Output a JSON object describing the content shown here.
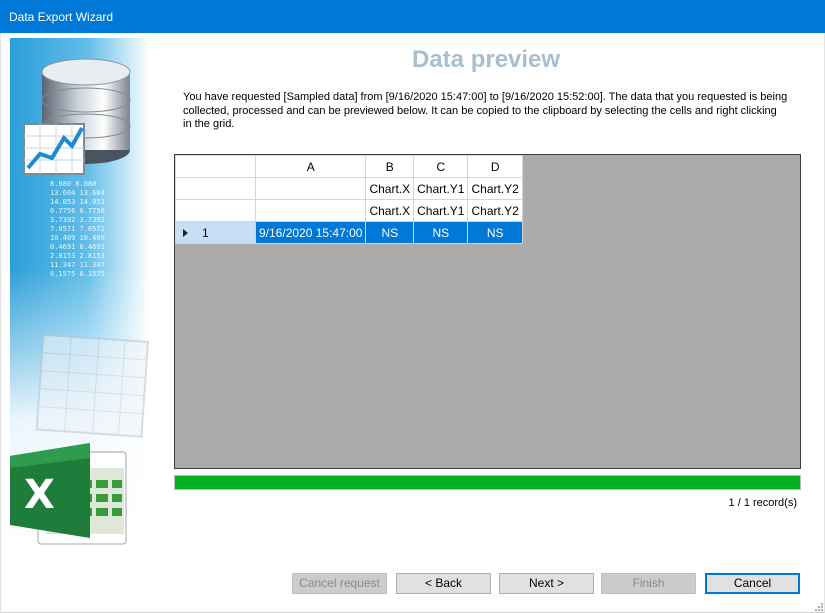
{
  "window": {
    "title": "Data Export Wizard"
  },
  "page": {
    "heading": "Data preview",
    "description": "You have requested [Sampled data] from [9/16/2020 15:47:00] to [9/16/2020 15:52:00]. The data that you requested is being collected, processed and can be previewed below. It can be copied to the clipboard by selecting the cells and right clicking in the grid."
  },
  "grid": {
    "column_headers": [
      "A",
      "B",
      "C",
      "D"
    ],
    "header_rows": [
      [
        "",
        "Chart.X",
        "Chart.Y1",
        "Chart.Y2"
      ],
      [
        "",
        "Chart.X",
        "Chart.Y1",
        "Chart.Y2"
      ]
    ],
    "rows": [
      {
        "index": "1",
        "cells": [
          "9/16/2020 15:47:00",
          "NS",
          "NS",
          "NS"
        ]
      }
    ]
  },
  "progress": {
    "value": 1.0,
    "color": "#06b025"
  },
  "record_count": "1 / 1 record(s)",
  "buttons": {
    "cancel_request": "Cancel request",
    "back": "< Back",
    "next": "Next >",
    "finish": "Finish",
    "cancel": "Cancel"
  },
  "sidebar_digits": [
    "8.880  8.880",
    "13.604  13.604",
    "14.053  14.053",
    "6.7756  6.7756",
    "3.7392  3.7392",
    "7.0571  7.0571",
    "10.409  10.409",
    "0.4691  0.4691",
    "2.8153  2.8153",
    "11.347  11.347",
    "6.1575  6.1575"
  ],
  "colors": {
    "accent": "#0078d7",
    "heading": "#a8bfcf"
  }
}
